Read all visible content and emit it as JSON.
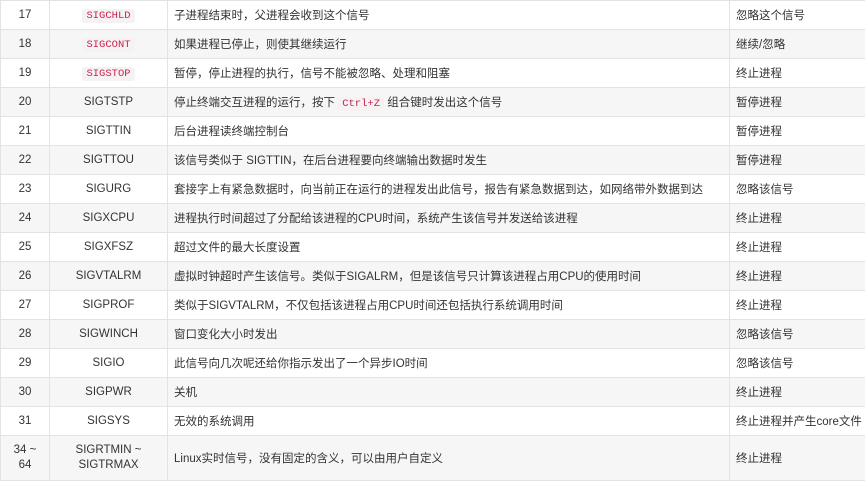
{
  "rows": [
    {
      "num": "17",
      "name": "SIGCHLD",
      "name_code": true,
      "desc": "子进程结束时，父进程会收到这个信号",
      "action": "忽略这个信号"
    },
    {
      "num": "18",
      "name": "SIGCONT",
      "name_code": true,
      "desc": "如果进程已停止，则使其继续运行",
      "action": "继续/忽略"
    },
    {
      "num": "19",
      "name": "SIGSTOP",
      "name_code": true,
      "desc": "暂停，停止进程的执行，信号不能被忽略、处理和阻塞",
      "action": "终止进程"
    },
    {
      "num": "20",
      "name": "SIGTSTP",
      "desc_pre": "停止终端交互进程的运行，按下 ",
      "desc_code": "Ctrl+Z",
      "desc_post": " 组合键时发出这个信号",
      "action": "暂停进程"
    },
    {
      "num": "21",
      "name": "SIGTTIN",
      "desc": "后台进程读终端控制台",
      "action": "暂停进程"
    },
    {
      "num": "22",
      "name": "SIGTTOU",
      "desc": "该信号类似于 SIGTTIN，在后台进程要向终端输出数据时发生",
      "action": "暂停进程"
    },
    {
      "num": "23",
      "name": "SIGURG",
      "desc": "套接字上有紧急数据时，向当前正在运行的进程发出此信号，报告有紧急数据到达，如网络带外数据到达",
      "action": "忽略该信号"
    },
    {
      "num": "24",
      "name": "SIGXCPU",
      "desc": "进程执行时间超过了分配给该进程的CPU时间，系统产生该信号并发送给该进程",
      "action": "终止进程"
    },
    {
      "num": "25",
      "name": "SIGXFSZ",
      "desc": "超过文件的最大长度设置",
      "action": "终止进程"
    },
    {
      "num": "26",
      "name": "SIGVTALRM",
      "desc": "虚拟时钟超时产生该信号。类似于SIGALRM，但是该信号只计算该进程占用CPU的使用时间",
      "action": "终止进程"
    },
    {
      "num": "27",
      "name": "SIGPROF",
      "desc": "类似于SIGVTALRM，不仅包括该进程占用CPU时间还包括执行系统调用时间",
      "action": "终止进程"
    },
    {
      "num": "28",
      "name": "SIGWINCH",
      "desc": "窗口变化大小时发出",
      "action": "忽略该信号"
    },
    {
      "num": "29",
      "name": "SIGIO",
      "desc": "此信号向几次呢还给你指示发出了一个异步IO时间",
      "action": "忽略该信号"
    },
    {
      "num": "30",
      "name": "SIGPWR",
      "desc": "关机",
      "action": "终止进程"
    },
    {
      "num": "31",
      "name": "SIGSYS",
      "desc": "无效的系统调用",
      "action": "终止进程并产生core文件"
    },
    {
      "num_line1": "34 ~",
      "num_line2": "64",
      "name_line1": "SIGRTMIN ~",
      "name_line2": "SIGTRMAX",
      "desc": "Linux实时信号，没有固定的含义，可以由用户自定义",
      "action": "终止进程"
    }
  ]
}
